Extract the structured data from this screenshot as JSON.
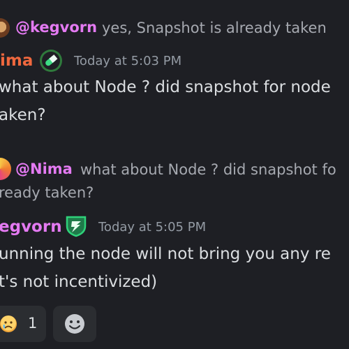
{
  "reply1": {
    "author": "@kegvorn",
    "text": "yes, Snapshot is already taken"
  },
  "message1": {
    "author": "ima",
    "author_color": "#f0683e",
    "timestamp": "Today at 5:03 PM",
    "lines": [
      "what about Node ? did snapshot for node",
      "aken?"
    ]
  },
  "reply2": {
    "author": "@Nima",
    "line1": "what about Node ? did snapshot fo",
    "line2": "ready taken?"
  },
  "message2": {
    "author": "egvorn",
    "author_color": "#e47af2",
    "timestamp": "Today at 5:05 PM",
    "lines": [
      "unning the node will not bring you any re",
      "t's not incentivized)"
    ]
  },
  "reactions": [
    {
      "emoji": "sad-crying-face-icon",
      "count": "1"
    }
  ],
  "icons": {
    "add_reaction": "smiley-add-reaction-icon"
  }
}
